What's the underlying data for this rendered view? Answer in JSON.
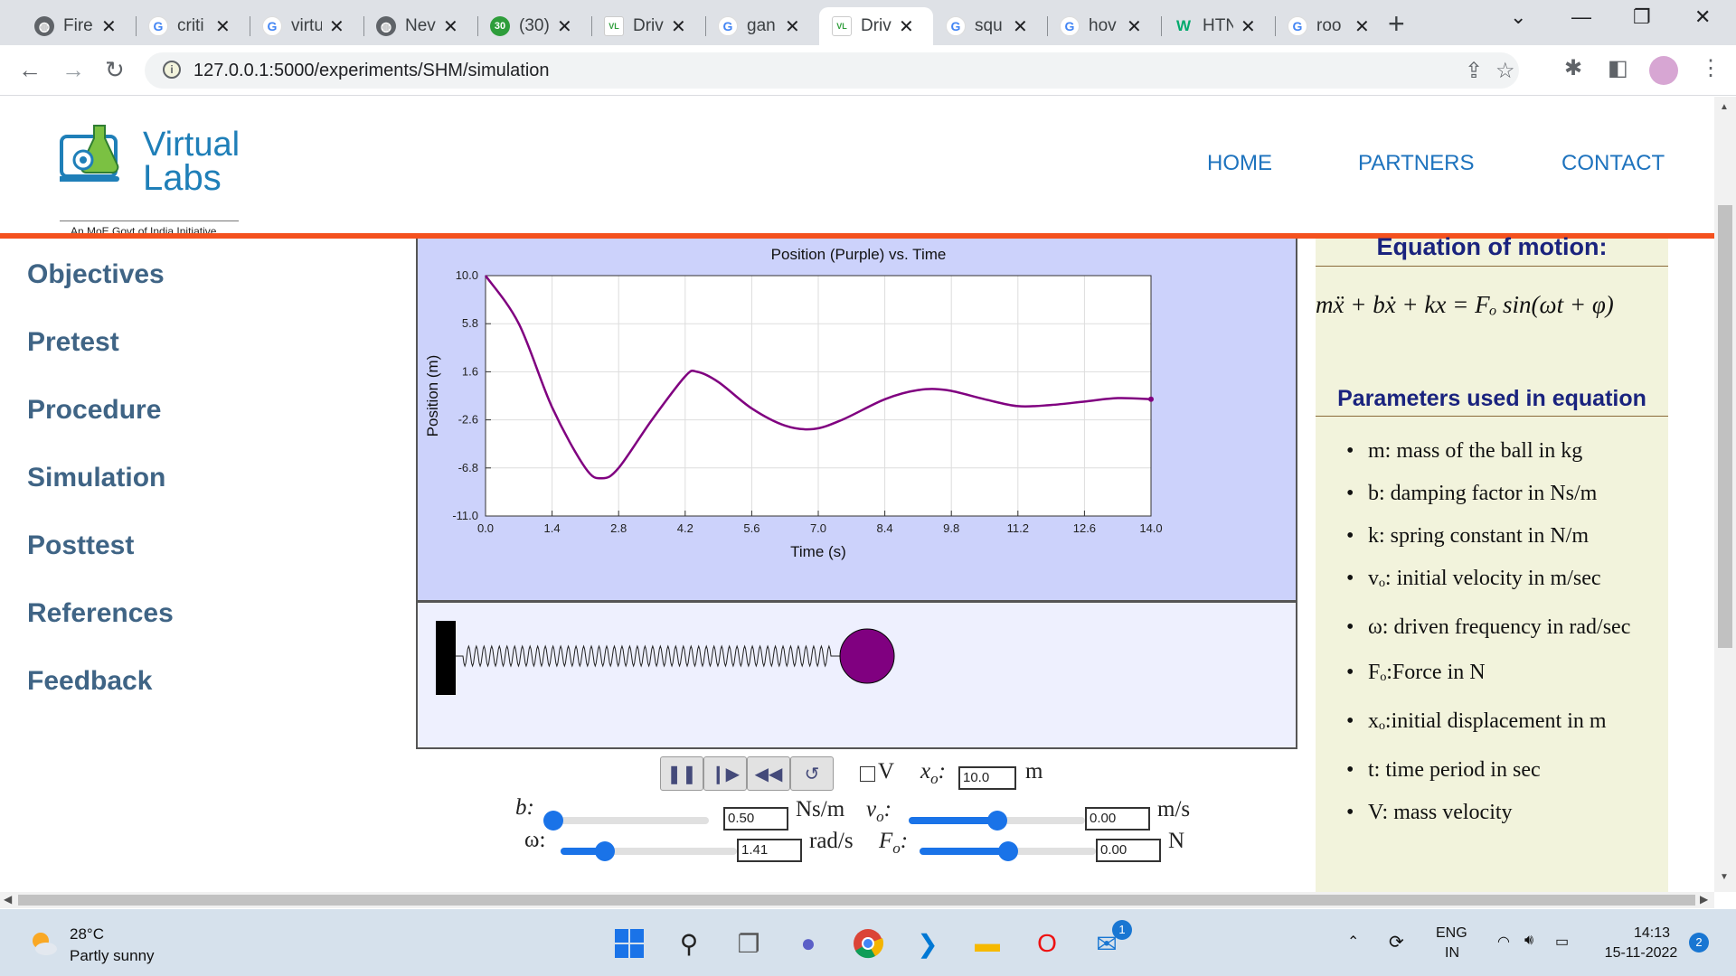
{
  "browser": {
    "tabs": [
      {
        "label": "Fire",
        "icon": "globe-icon"
      },
      {
        "label": "criti",
        "icon": "google-icon"
      },
      {
        "label": "virtu",
        "icon": "google-icon"
      },
      {
        "label": "Nev",
        "icon": "globe-icon"
      },
      {
        "label": "(30)",
        "icon": "badge-30-icon",
        "badge": "30"
      },
      {
        "label": "Driv",
        "icon": "virtual-labs-icon"
      },
      {
        "label": "gan",
        "icon": "google-icon"
      },
      {
        "label": "Driv",
        "icon": "virtual-labs-icon",
        "active": true
      },
      {
        "label": "squ",
        "icon": "google-icon"
      },
      {
        "label": "hov",
        "icon": "google-icon"
      },
      {
        "label": "HTN",
        "icon": "w3schools-icon"
      },
      {
        "label": "roo",
        "icon": "google-icon"
      }
    ],
    "url": "127.0.0.1:5000/experiments/SHM/simulation"
  },
  "site": {
    "logo_line1": "Virtual",
    "logo_line2": "Labs",
    "logo_tagline": "An MoE Govt of India Initiative",
    "nav": [
      "HOME",
      "PARTNERS",
      "CONTACT"
    ],
    "sidebar": [
      "Objectives",
      "Pretest",
      "Procedure",
      "Simulation",
      "Posttest",
      "References",
      "Feedback"
    ]
  },
  "chart_data": {
    "type": "line",
    "title": "Position (Purple) vs. Time",
    "xlabel": "Time (s)",
    "ylabel": "Position (m)",
    "xlim": [
      0,
      14
    ],
    "ylim": [
      -11,
      10
    ],
    "xticks": [
      "0.0",
      "1.4",
      "2.8",
      "4.2",
      "5.6",
      "7.0",
      "8.4",
      "9.8",
      "11.2",
      "12.6",
      "14.0"
    ],
    "yticks": [
      "10.0",
      "5.8",
      "1.6",
      "-2.6",
      "-6.8",
      "-11.0"
    ],
    "grid": true,
    "series": [
      {
        "color": "#800080",
        "x": [
          0,
          0.7,
          1.4,
          2.1,
          2.45,
          2.8,
          3.5,
          4.2,
          4.45,
          4.9,
          5.6,
          6.3,
          6.9,
          7.5,
          8.4,
          9.1,
          9.7,
          10.5,
          11.2,
          11.9,
          12.6,
          13.3,
          14.0
        ],
        "y": [
          10.0,
          5.8,
          -1.5,
          -6.8,
          -7.7,
          -6.8,
          -2.6,
          1.2,
          1.6,
          0.7,
          -1.6,
          -3.1,
          -3.4,
          -2.6,
          -0.8,
          0.0,
          0.0,
          -0.8,
          -1.4,
          -1.3,
          -1.0,
          -0.7,
          -0.8
        ]
      }
    ]
  },
  "controls": {
    "buttons": [
      "pause-icon",
      "step-forward-icon",
      "rewind-icon",
      "reset-icon"
    ],
    "v_checkbox_label": "V",
    "x0_label": "x",
    "x0_sub": "o",
    "x0_value": "10.0",
    "x0_unit": "m",
    "b_label": "b:",
    "b_value": "0.50",
    "b_unit": "Ns/m",
    "b_fraction": 0.03,
    "v0_label": "v",
    "v0_sub": "o",
    "v0_value": "0.00",
    "v0_unit": "m/s",
    "v0_fraction": 0.5,
    "omega_label": "ω:",
    "omega_value": "1.41",
    "omega_unit": "rad/s",
    "omega_fraction": 0.25,
    "F0_label": "F",
    "F0_sub": "o",
    "F0_value": "0.00",
    "F0_unit": "N",
    "F0_fraction": 0.5
  },
  "info": {
    "equation_heading": "Equation of motion:",
    "equation": "mẍ + bẋ + kx = Fₒ sin(ωt + φ)",
    "params_heading": "Parameters used in equation",
    "params": [
      "m: mass of the ball in kg",
      "b: damping factor in Ns/m",
      "k: spring constant in N/m",
      "vₒ: initial velocity in m/sec",
      "ω: driven frequency in rad/sec",
      "Fₒ:Force in N",
      "xₒ:initial displacement in m",
      "t: time period in sec",
      "V: mass velocity"
    ]
  },
  "taskbar": {
    "temperature": "28°C",
    "weather": "Partly sunny",
    "lang1": "ENG",
    "lang2": "IN",
    "time": "14:13",
    "date": "15-11-2022",
    "notif_count": "2",
    "mail_badge": "1"
  }
}
